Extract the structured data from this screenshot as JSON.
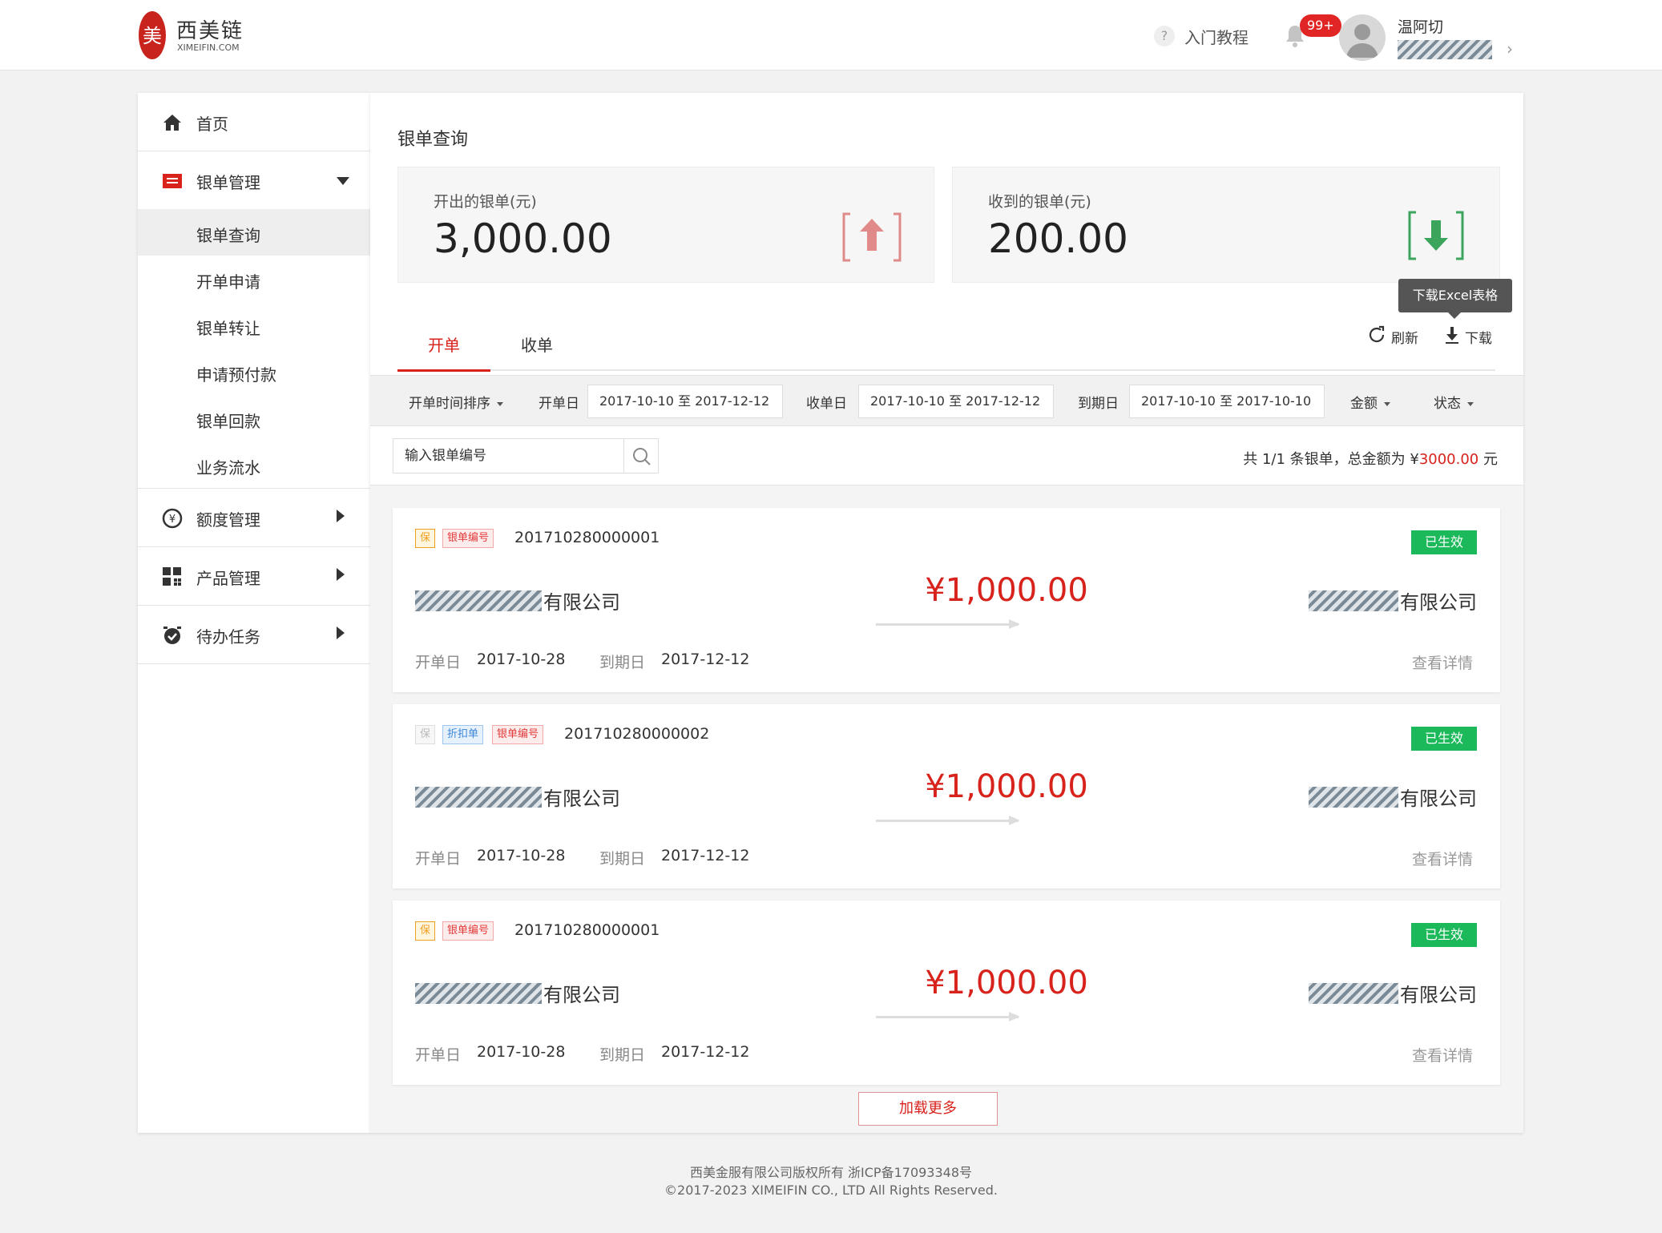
{
  "header": {
    "logo_char": "美",
    "logo_name": "西美链",
    "logo_sub": "XIMEIFIN.COM",
    "help_label": "入门教程",
    "notify_badge": "99+",
    "user_name": "温阿切"
  },
  "sidebar": {
    "home": "首页",
    "bill_mgmt": "银单管理",
    "sub": [
      "银单查询",
      "开单申请",
      "银单转让",
      "申请预付款",
      "银单回款",
      "业务流水"
    ],
    "quota": "额度管理",
    "product": "产品管理",
    "todo": "待办任务"
  },
  "main": {
    "title": "银单查询",
    "issued_label": "开出的银单(元)",
    "issued_value": "3,000.00",
    "received_label": "收到的银单(元)",
    "received_value": "200.00",
    "tab_issue": "开单",
    "tab_receive": "收单",
    "refresh": "刷新",
    "download": "下载",
    "tooltip": "下载Excel表格",
    "filters": {
      "sort": "开单时间排序",
      "issue_label": "开单日",
      "issue_range": "2017-10-10 至 2017-12-12",
      "receive_label": "收单日",
      "receive_range": "2017-10-10 至 2017-12-12",
      "due_label": "到期日",
      "due_range": "2017-10-10 至 2017-10-10",
      "amount": "金额",
      "status": "状态"
    },
    "search_placeholder": "输入银单编号",
    "summary_prefix": "共 1/1 条银单，总金额为 ¥",
    "summary_amount": "3000.00",
    "summary_suffix": " 元"
  },
  "bills": [
    {
      "tag_bao": "保",
      "tag_num": "银单编号",
      "number": "201710280000001",
      "status": "已生效",
      "company": "有限公司",
      "amount": "¥1,000.00",
      "issue_label": "开单日",
      "issue_date": "2017-10-28",
      "due_label": "到期日",
      "due_date": "2017-12-12",
      "detail": "查看详情"
    },
    {
      "tag_bao": "保",
      "tag_disc": "折扣单",
      "tag_num": "银单编号",
      "number": "201710280000002",
      "status": "已生效",
      "company": "有限公司",
      "amount": "¥1,000.00",
      "issue_label": "开单日",
      "issue_date": "2017-10-28",
      "due_label": "到期日",
      "due_date": "2017-12-12",
      "detail": "查看详情"
    },
    {
      "tag_bao": "保",
      "tag_num": "银单编号",
      "number": "201710280000001",
      "status": "已生效",
      "company": "有限公司",
      "amount": "¥1,000.00",
      "issue_label": "开单日",
      "issue_date": "2017-10-28",
      "due_label": "到期日",
      "due_date": "2017-12-12",
      "detail": "查看详情"
    }
  ],
  "load_more": "加载更多",
  "footer": {
    "line1": "西美金服有限公司版权所有 浙ICP备17093348号",
    "line2": "©2017-2023 XIMEIFIN  CO., LTD All Rights Reserved."
  },
  "colors": {
    "accent": "#d8221c",
    "success": "#1cb95b",
    "download_green": "#3ba55c"
  }
}
